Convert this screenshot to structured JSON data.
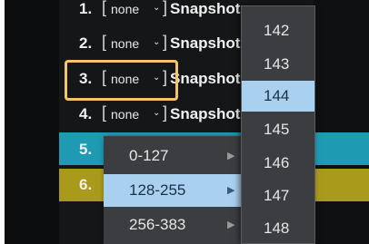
{
  "rows": [
    {
      "num": "1.",
      "select": "none",
      "name": "Snapshot"
    },
    {
      "num": "2.",
      "select": "none",
      "name": "Snapshot"
    },
    {
      "num": "3.",
      "select": "none",
      "name": "Snapshot"
    },
    {
      "num": "4.",
      "select": "none",
      "name": "Snapshot"
    },
    {
      "num": "5.",
      "color": "#1e9ab2"
    },
    {
      "num": "6.",
      "color": "#aa9a1c"
    }
  ],
  "bracket_open": "[",
  "bracket_close": "]",
  "highlight_color": "#f3c56b",
  "chevron_icon": "chevron-down-icon",
  "submenu": {
    "items": [
      "0-127",
      "128-255",
      "256-383"
    ],
    "active_index": 1,
    "arrow_icon": "chevron-right-icon"
  },
  "number_list": {
    "items": [
      "142",
      "143",
      "144",
      "145",
      "146",
      "147",
      "148"
    ],
    "active_value": "144"
  }
}
